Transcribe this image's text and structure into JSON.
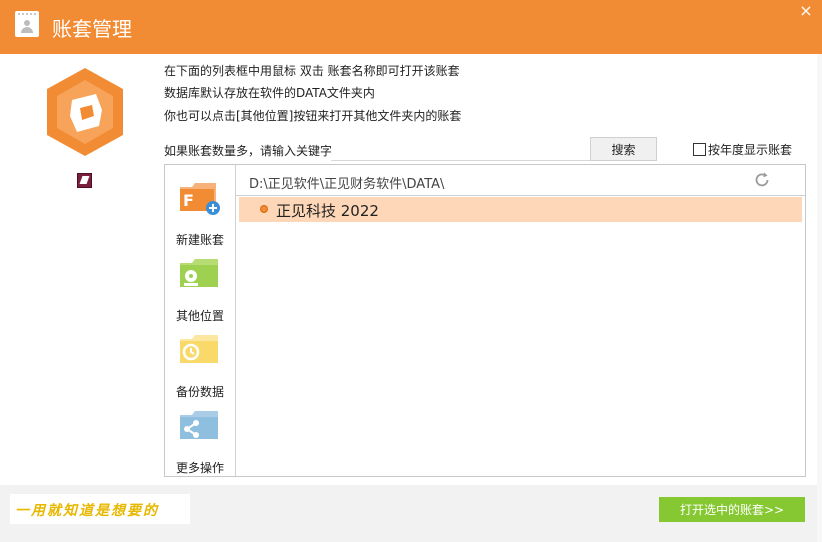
{
  "window": {
    "title": "账套管理",
    "close_label": "×"
  },
  "info_lines": [
    "在下面的列表框中用鼠标 双击 账套名称即可打开该账套",
    "数据库默认存放在软件的DATA文件夹内",
    "你也可以点击[其他位置]按钮来打开其他文件夹内的账套"
  ],
  "search": {
    "label": "如果账套数量多，请输入关键字",
    "value": "",
    "button": "搜索"
  },
  "year_checkbox": {
    "label": "按年度显示账套",
    "checked": false
  },
  "tools": [
    {
      "label": "新建账套",
      "icon": "new-ledger-icon"
    },
    {
      "label": "其他位置",
      "icon": "other-location-icon"
    },
    {
      "label": "备份数据",
      "icon": "backup-icon"
    },
    {
      "label": "更多操作",
      "icon": "more-actions-icon"
    }
  ],
  "path": "D:\\正见软件\\正见财务软件\\DATA\\",
  "ledgers": [
    {
      "name": "正见科技 2022",
      "selected": true
    }
  ],
  "slogan": "一用就知道是想要的",
  "open_button": "打开选中的账套>>",
  "colors": {
    "titlebar": "#f28c34",
    "selected_row": "#fdd7b7",
    "open_button": "#86c832",
    "logo": "#f28c34"
  }
}
